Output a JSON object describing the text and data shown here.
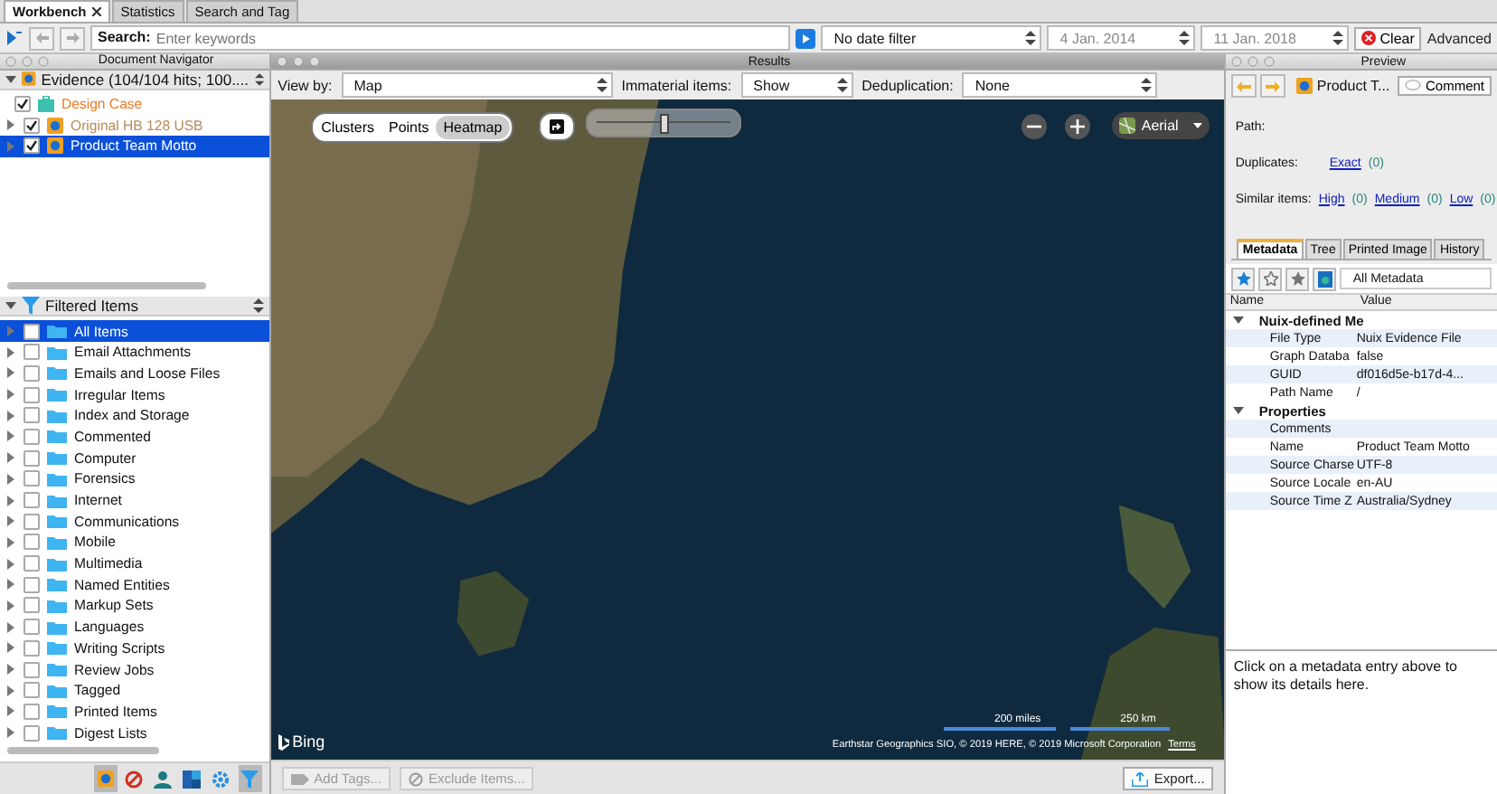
{
  "tabs": [
    {
      "label": "Workbench",
      "selected": true,
      "closable": true
    },
    {
      "label": "Statistics",
      "selected": false,
      "closable": false
    },
    {
      "label": "Search and Tag",
      "selected": false,
      "closable": false
    }
  ],
  "search": {
    "label": "Search:",
    "placeholder": "Enter keywords",
    "date_filter": "No date filter",
    "start_date": "4 Jan. 2014",
    "end_date": "11 Jan. 2018",
    "clear_button": "Clear",
    "advanced_link": "Advanced"
  },
  "navigator": {
    "title": "Document Navigator",
    "evidence_selector": "Evidence (104/104 hits; 100....",
    "items": [
      {
        "label": "Design Case",
        "kind": "case",
        "checked": true,
        "selected": false
      },
      {
        "label": "Original HB 128 USB",
        "kind": "evidence",
        "checked": true,
        "selected": false
      },
      {
        "label": "Product Team Motto",
        "kind": "evidence",
        "checked": true,
        "selected": true
      }
    ]
  },
  "filtered_items": {
    "title": "Filtered Items",
    "items": [
      {
        "label": "All Items",
        "checked": false,
        "selected": true
      },
      {
        "label": "Email Attachments",
        "checked": false,
        "selected": false
      },
      {
        "label": "Emails and Loose Files",
        "checked": false,
        "selected": false
      },
      {
        "label": "Irregular Items",
        "checked": false,
        "selected": false
      },
      {
        "label": "Index and Storage",
        "checked": false,
        "selected": false
      },
      {
        "label": "Commented",
        "checked": false,
        "selected": false
      },
      {
        "label": "Computer",
        "checked": false,
        "selected": false
      },
      {
        "label": "Forensics",
        "checked": false,
        "selected": false
      },
      {
        "label": "Internet",
        "checked": false,
        "selected": false
      },
      {
        "label": "Communications",
        "checked": false,
        "selected": false
      },
      {
        "label": "Mobile",
        "checked": false,
        "selected": false
      },
      {
        "label": "Multimedia",
        "checked": false,
        "selected": false
      },
      {
        "label": "Named Entities",
        "checked": false,
        "selected": false
      },
      {
        "label": "Markup Sets",
        "checked": false,
        "selected": false
      },
      {
        "label": "Languages",
        "checked": false,
        "selected": false
      },
      {
        "label": "Writing Scripts",
        "checked": false,
        "selected": false
      },
      {
        "label": "Review Jobs",
        "checked": false,
        "selected": false
      },
      {
        "label": "Tagged",
        "checked": false,
        "selected": false
      },
      {
        "label": "Printed Items",
        "checked": false,
        "selected": false
      },
      {
        "label": "Digest Lists",
        "checked": false,
        "selected": false
      }
    ]
  },
  "toolbar": [
    {
      "kind": "evidence",
      "selected": true
    },
    {
      "kind": "blocked",
      "selected": false
    },
    {
      "kind": "person",
      "selected": false
    },
    {
      "kind": "tiles",
      "selected": false
    },
    {
      "kind": "gear",
      "selected": false
    },
    {
      "kind": "filter",
      "selected": true
    }
  ],
  "results": {
    "title": "Results",
    "view_by": {
      "label": "View by:",
      "value": "Map"
    },
    "immaterial": {
      "label": "Immaterial items:",
      "value": "Show"
    },
    "deduplication": {
      "label": "Deduplication:",
      "value": "None"
    },
    "map_modes": [
      {
        "label": "Clusters",
        "selected": false
      },
      {
        "label": "Points",
        "selected": false
      },
      {
        "label": "Heatmap",
        "selected": true
      }
    ],
    "zoom": {
      "level": 0.5
    },
    "map_type": "Aerial",
    "provider": "Bing",
    "scale": [
      "200 miles",
      "250 km"
    ],
    "attribution": "Earthstar Geographics SIO, © 2019 HERE, © 2019 Microsoft Corporation",
    "terms_link": "Terms",
    "actions": [
      {
        "label": "Add Tags...",
        "disabled": true
      },
      {
        "label": "Exclude Items...",
        "disabled": true
      }
    ],
    "export_button": "Export..."
  },
  "preview": {
    "title": "Preview",
    "document": "Product T...",
    "comment_button": "Comment",
    "path_label": "Path:",
    "duplicates": {
      "label": "Duplicates:",
      "links": [
        {
          "label": "Exact",
          "count": "(0)"
        }
      ]
    },
    "similar": {
      "label": "Similar items:",
      "links": [
        {
          "label": "High",
          "count": "(0)"
        },
        {
          "label": "Medium",
          "count": "(0)"
        },
        {
          "label": "Low",
          "count": "(0)"
        }
      ]
    },
    "tabs": [
      {
        "label": "Metadata",
        "selected": true
      },
      {
        "label": "Tree",
        "selected": false
      },
      {
        "label": "Printed Image",
        "selected": false
      },
      {
        "label": "History",
        "selected": false
      }
    ],
    "metadata_filter": "All Metadata",
    "columns": [
      "Name",
      "Value"
    ],
    "groups": [
      {
        "name": "Nuix-defined Me",
        "expanded": true,
        "rows": [
          {
            "name": "File Type",
            "value": "Nuix Evidence File"
          },
          {
            "name": "Graph Databa",
            "value": "false"
          },
          {
            "name": "GUID",
            "value": "df016d5e-b17d-4..."
          },
          {
            "name": "Path Name",
            "value": "/"
          }
        ]
      },
      {
        "name": "Properties",
        "expanded": true,
        "rows": [
          {
            "name": "Comments",
            "value": ""
          },
          {
            "name": "Name",
            "value": "Product Team Motto"
          },
          {
            "name": "Source Charse",
            "value": "UTF-8"
          },
          {
            "name": "Source Locale",
            "value": "en-AU"
          },
          {
            "name": "Source Time Z",
            "value": "Australia/Sydney"
          }
        ]
      }
    ],
    "detail_hint": "Click on a metadata entry above to show its details here."
  }
}
